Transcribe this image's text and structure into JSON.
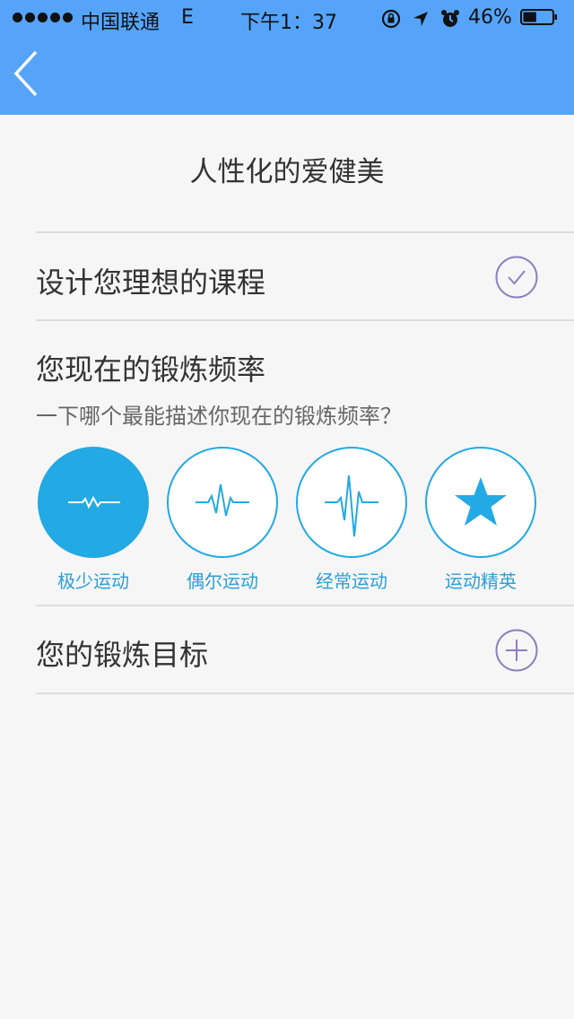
{
  "status_bar": {
    "carrier": "中国联通",
    "network": "E",
    "time": "下午1：37",
    "battery": "46%",
    "battery_level": 0.46,
    "icons": [
      "rotation-lock-icon",
      "location-arrow-icon",
      "alarm-icon"
    ]
  },
  "nav": {
    "back_icon": "chevron-left-icon"
  },
  "page": {
    "title": "人性化的爱健美"
  },
  "course": {
    "label": "设计您理想的课程",
    "icon": "check-circle-icon"
  },
  "frequency": {
    "title": "您现在的锻炼频率",
    "subtitle": "一下哪个最能描述你现在的锻炼频率？",
    "options": [
      {
        "label": "极少运动",
        "icon": "small-pulse-icon",
        "selected": true
      },
      {
        "label": "偶尔运动",
        "icon": "medium-pulse-icon",
        "selected": false
      },
      {
        "label": "经常运动",
        "icon": "high-pulse-icon",
        "selected": false
      },
      {
        "label": "运动精英",
        "icon": "star-icon",
        "selected": false
      }
    ]
  },
  "goal": {
    "label": "您的锻炼目标",
    "icon": "add-circle-icon"
  },
  "colors": {
    "header": "#55a4f9",
    "accent": "#23a9e3",
    "purple": "#8e7fc0",
    "background": "#f6f6f6"
  }
}
